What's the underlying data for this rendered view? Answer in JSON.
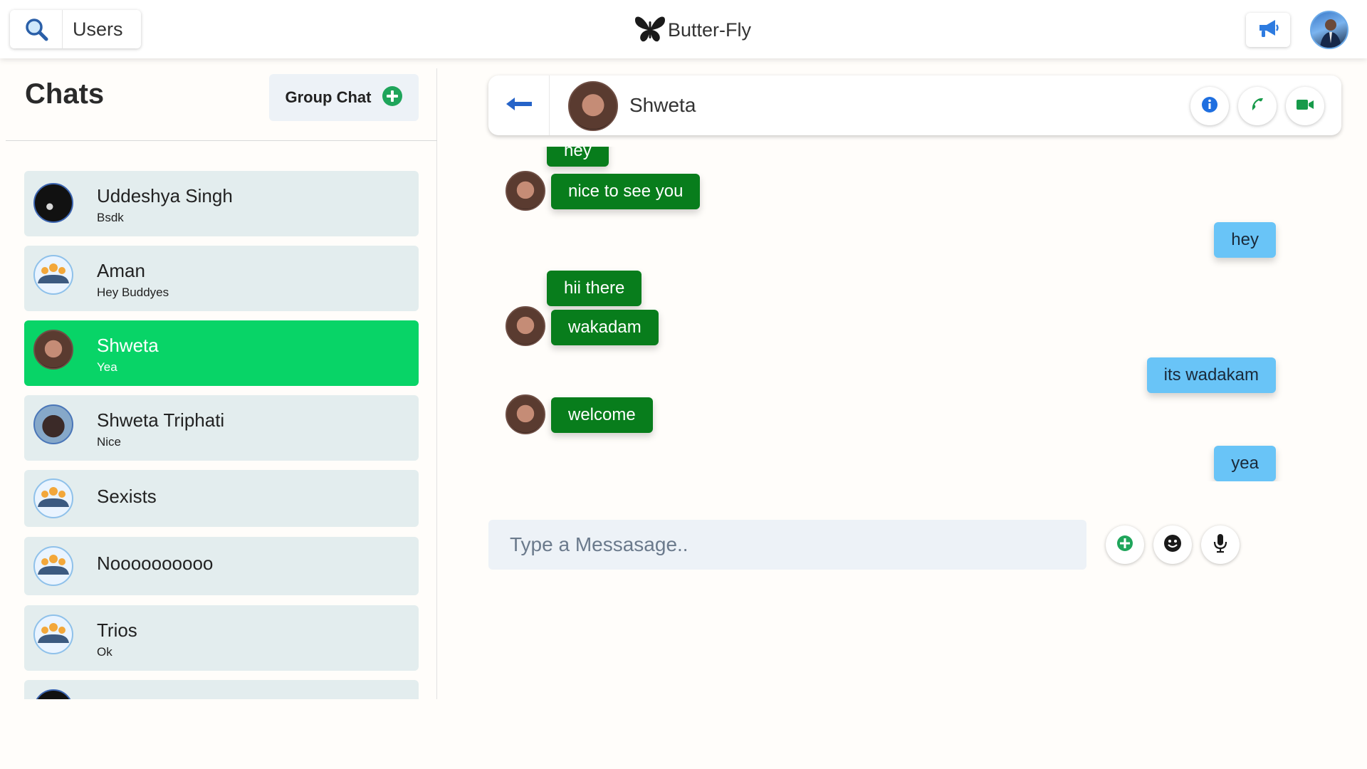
{
  "header": {
    "search_label": "Users",
    "brand_name": "Butter-Fly",
    "brand_icon": "butterfly-icon",
    "notification_icon": "megaphone-icon"
  },
  "sidebar": {
    "title": "Chats",
    "group_chat_label": "Group Chat",
    "chats": [
      {
        "name": "Uddeshya Singh",
        "preview": "Bsdk",
        "avatar": "photo",
        "active": false
      },
      {
        "name": "Aman",
        "preview": "Hey Buddyes",
        "avatar": "group-icon",
        "active": false
      },
      {
        "name": "Shweta",
        "preview": "Yea",
        "avatar": "photo",
        "active": true
      },
      {
        "name": "Shweta Triphati",
        "preview": "Nice",
        "avatar": "photo",
        "active": false
      },
      {
        "name": "Sexists",
        "preview": "",
        "avatar": "group-icon",
        "active": false
      },
      {
        "name": "Noooooooooo",
        "preview": "",
        "avatar": "group-icon",
        "active": false
      },
      {
        "name": "Trios",
        "preview": "Ok",
        "avatar": "group-icon",
        "active": false
      }
    ]
  },
  "chat": {
    "contact_name": "Shweta",
    "messages": [
      {
        "text": "hey",
        "direction": "in"
      },
      {
        "text": "nice to see you",
        "direction": "in"
      },
      {
        "text": "hey",
        "direction": "out"
      },
      {
        "text": "hii there",
        "direction": "in"
      },
      {
        "text": "wakadam",
        "direction": "in"
      },
      {
        "text": "its wadakam",
        "direction": "out"
      },
      {
        "text": "welcome",
        "direction": "in"
      },
      {
        "text": "yea",
        "direction": "out"
      }
    ],
    "composer_placeholder": "Type a Messasage.."
  },
  "colors": {
    "active_chat": "#08d467",
    "incoming_bubble": "#087d1c",
    "outgoing_bubble": "#69c4f7"
  }
}
